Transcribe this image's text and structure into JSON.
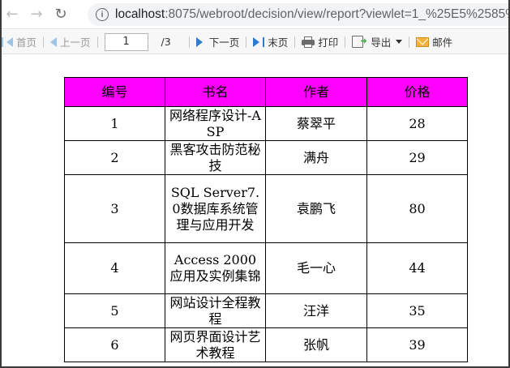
{
  "browser": {
    "url_host": "localhost",
    "url_path": ":8075/webroot/decision/view/report?viewlet=1_%25E5%2585%"
  },
  "toolbar": {
    "first_label": "首页",
    "prev_label": "上一页",
    "page_value": "1",
    "page_total": "/3",
    "next_label": "下一页",
    "last_label": "末页",
    "print_label": "打印",
    "export_label": "导出",
    "mail_label": "邮件"
  },
  "table": {
    "headers": [
      "编号",
      "书名",
      "作者",
      "价格"
    ],
    "header_color": "#ff00ff",
    "rows": [
      {
        "id": "1",
        "title": "网络程序设计-ASP",
        "author": "蔡翠平",
        "price": "28"
      },
      {
        "id": "2",
        "title": "黑客攻击防范秘技",
        "author": "满舟",
        "price": "29"
      },
      {
        "id": "3",
        "title": "SQL Server7.0数据库系统管理与应用开发",
        "author": "袁鹏飞",
        "price": "80"
      },
      {
        "id": "4",
        "title": "Access 2000应用及实例集锦",
        "author": "毛一心",
        "price": "44"
      },
      {
        "id": "5",
        "title": "网站设计全程教程",
        "author": "汪洋",
        "price": "35"
      },
      {
        "id": "6",
        "title": "网页界面设计艺术教程",
        "author": "张帆",
        "price": "39"
      }
    ]
  }
}
